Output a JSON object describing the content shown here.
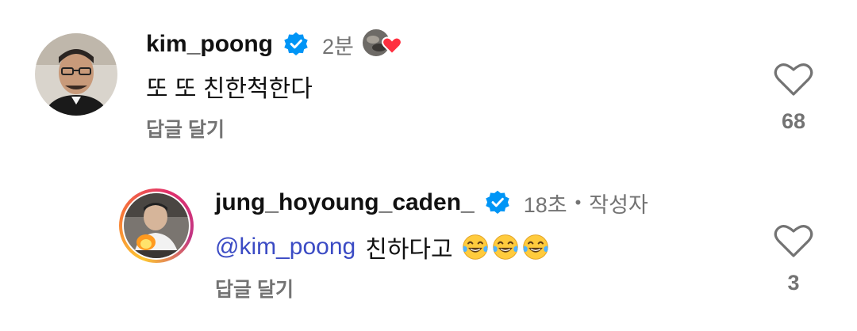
{
  "comments": [
    {
      "username": "kim_poong",
      "time": "2분",
      "text": "또 또 친한척한다",
      "reply_label": "답글 달기",
      "likes": "68",
      "verified": true
    },
    {
      "username": "jung_hoyoung_caden_",
      "time": "18초",
      "separator": "•",
      "author_label": "작성자",
      "mention": "@kim_poong",
      "text": "친하다고",
      "emoji_count": 3,
      "emoji_name": "face-with-tears-of-joy",
      "reply_label": "답글 달기",
      "likes": "3",
      "verified": true
    }
  ],
  "colors": {
    "verified_blue": "#0095f6",
    "mention_blue": "#3b4bc4",
    "secondary_text": "#737373",
    "reaction_heart": "#ff3040"
  }
}
